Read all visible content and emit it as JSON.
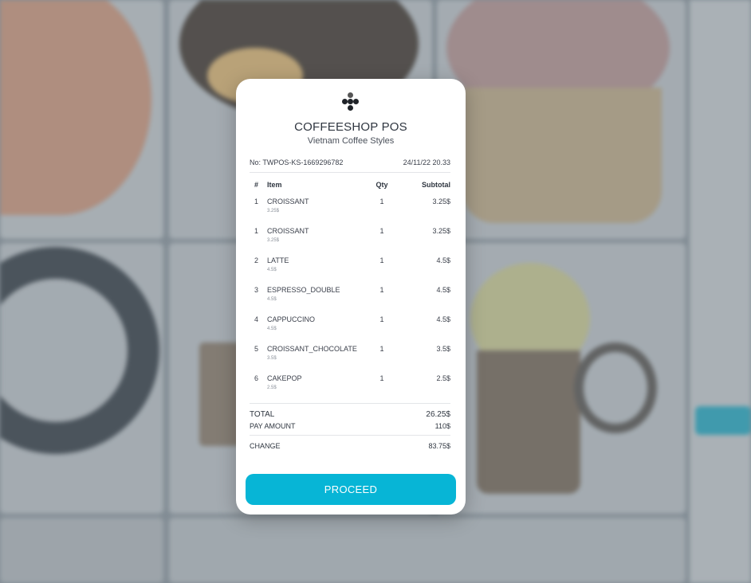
{
  "receipt": {
    "title": "COFFEESHOP POS",
    "subtitle": "Vietnam Coffee Styles",
    "number": "No: TWPOS-KS-1669296782",
    "datetime": "24/11/22 20.33",
    "headers": {
      "num": "#",
      "item": "Item",
      "qty": "Qty",
      "subtotal": "Subtotal"
    },
    "items": [
      {
        "num": "1",
        "name": "CROISSANT",
        "price": "3.25$",
        "qty": "1",
        "subtotal": "3.25$"
      },
      {
        "num": "1",
        "name": "CROISSANT",
        "price": "3.25$",
        "qty": "1",
        "subtotal": "3.25$"
      },
      {
        "num": "2",
        "name": "LATTE",
        "price": "4.5$",
        "qty": "1",
        "subtotal": "4.5$"
      },
      {
        "num": "3",
        "name": "ESPRESSO_DOUBLE",
        "price": "4.5$",
        "qty": "1",
        "subtotal": "4.5$"
      },
      {
        "num": "4",
        "name": "CAPPUCCINO",
        "price": "4.5$",
        "qty": "1",
        "subtotal": "4.5$"
      },
      {
        "num": "5",
        "name": "CROISSANT_CHOCOLATE",
        "price": "3.5$",
        "qty": "1",
        "subtotal": "3.5$"
      },
      {
        "num": "6",
        "name": "CAKEPOP",
        "price": "2.5$",
        "qty": "1",
        "subtotal": "2.5$"
      }
    ],
    "total_label": "TOTAL",
    "total_value": "26.25$",
    "pay_label": "PAY AMOUNT",
    "pay_value": "110$",
    "change_label": "CHANGE",
    "change_value": "83.75$",
    "proceed_label": "PROCEED"
  },
  "icons": {
    "logo": "coffeeshop-logo-icon"
  },
  "colors": {
    "accent": "#07b5d6",
    "modal_bg": "#ffffff"
  }
}
